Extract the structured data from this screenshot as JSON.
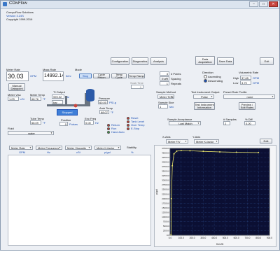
{
  "window": {
    "title": "CDivFlow",
    "company": "CompuFlow Solutions",
    "version": "Version 3.24S",
    "copyright": "Copyright 1999-2016"
  },
  "toolbar": {
    "configuration": "Configuration",
    "diagnostics": "Diagnostics",
    "analysis": "Analysis",
    "data_acquisition": "Data Acquisition",
    "save_data": "Save Data",
    "exit": "Exit"
  },
  "meter_rate": {
    "label": "Meter Rate",
    "value": "30.03",
    "unit": "GPM"
  },
  "mass_rate": {
    "label": "Mass Rate",
    "value": "14992.14",
    "unit": "lb/hr"
  },
  "mode": {
    "label": "Mode",
    "stop": "Stop",
    "cycle_piston": "Cycle Piston",
    "temp_cycle": "Temp Cycle",
    "temp_ramp": "Temp Ramp",
    "soak_time_label": "Soak Time",
    "soak_time_value": "0"
  },
  "manual_datapoint": "Manual Datapoint",
  "meter_visc": {
    "label": "Meter Visc",
    "value": "1.03",
    "unit": "cSt"
  },
  "meter_temp": {
    "label": "Meter Temp",
    "value": "68.76",
    "unit": "°F"
  },
  "ti_output": {
    "label": "TI Output",
    "value": "999.92",
    "unit": "Hz"
  },
  "bar": "bar",
  "pressure": {
    "label": "Pressure",
    "value": "60.00",
    "unit": "PSI-g"
  },
  "amb_temp": {
    "label": "Amb Temp",
    "value": "68.07",
    "unit": "°F"
  },
  "tank_status": "Stopped",
  "tube_temp": {
    "label": "Tube Temp",
    "value": "68.09",
    "unit": "°F"
  },
  "position": {
    "label": "Position",
    "value": "0",
    "unit": "Pulses"
  },
  "enc_freq": {
    "label": "Enc Freq",
    "value": "0.00",
    "unit": "Hz"
  },
  "indicators": [
    {
      "label": "Return",
      "color": "#d9342b"
    },
    {
      "label": "Run",
      "color": "#d9342b"
    },
    {
      "label": "Hand Auto",
      "color": "#2fae3a"
    },
    {
      "label": "Reset",
      "color": "#d9342b"
    },
    {
      "label": "Tank Level",
      "color": "#d9342b"
    },
    {
      "label": "Over Temp",
      "color": "#d9342b"
    },
    {
      "label": "E-Stop",
      "color": "#d9342b"
    }
  ],
  "fluid": {
    "label": "Fluid",
    "value": "water"
  },
  "sampling": {
    "num_points_label": "# Points",
    "num_points_value": "3",
    "spacing_label": "Spacing",
    "spacing_value": "Even",
    "repeats_label": "Repeats",
    "repeats_value": "1"
  },
  "direction": {
    "label": "Direction",
    "ascending": "Ascending",
    "descending": "Descending"
  },
  "volumetric_rate": {
    "label": "Volumetric Rate",
    "high_label": "High",
    "high_value": "37.65",
    "low_label": "Low",
    "low_value": "3.79",
    "unit": "GPM"
  },
  "sample_method": {
    "label": "Sample Method",
    "value": "Meter Time"
  },
  "test_output": {
    "label": "Test Instrument Output",
    "value": "Pulse"
  },
  "preset_profile": {
    "label": "Preset Rate Profile",
    "value": "none"
  },
  "sample_size": {
    "label": "Sample Size",
    "value": "1",
    "unit": "sec"
  },
  "test_info_btn": "Test Instrument Information",
  "preview_btn": "Preview / Edit Rates",
  "sample_acceptance": {
    "label": "Sample Acceptance",
    "value": "Last Match"
  },
  "num_samples": {
    "label": "# Samples",
    "value": "2"
  },
  "pct_diff": {
    "label": "% Diff",
    "value": "0.20"
  },
  "table": {
    "col_selects": [
      "Meter Rate",
      "Meter Frequency",
      "Meter Viscosity",
      "Meter K-factor"
    ],
    "units": [
      "GPM",
      "Hz",
      "cSt",
      "p/gal"
    ],
    "stability": "Stability",
    "stability_unit": "%"
  },
  "graph_ctrl": {
    "x_axis_label": "X-Axis",
    "x_axis_value": "Meter F/V",
    "y_axis_label": "Y-Axis",
    "y_axis_value": "Meter K-factor",
    "edit": "Edit"
  },
  "chart_data": {
    "type": "line",
    "xlabel": "Hz/cSt",
    "ylabel": "p/gal",
    "xlim": [
      0,
      900
    ],
    "ylim": [
      0,
      47500
    ],
    "x_ticks": [
      "0.0",
      "100.0",
      "200.0",
      "300.0",
      "400.0",
      "500.0",
      "600.0",
      "700.0",
      "800.0",
      "900.0"
    ],
    "y_ticks": [
      "0.0",
      "2500.0",
      "5000.0",
      "7500.0",
      "10000.0",
      "12500.0",
      "15000.0",
      "17500.0",
      "20000.0",
      "22500.0",
      "25000.0",
      "27500.0",
      "30000.0",
      "32500.0",
      "35000.0",
      "37500.0",
      "40000.0",
      "42500.0",
      "45000.0",
      "47500.0"
    ],
    "grid": true,
    "series": [
      {
        "color": "#e8e36a",
        "x": [
          8,
          12,
          20,
          35,
          60,
          100,
          180,
          300,
          450,
          600,
          800
        ],
        "y": [
          200,
          20000,
          38000,
          44500,
          46000,
          46300,
          46200,
          45900,
          45600,
          45400,
          45200
        ]
      }
    ]
  }
}
